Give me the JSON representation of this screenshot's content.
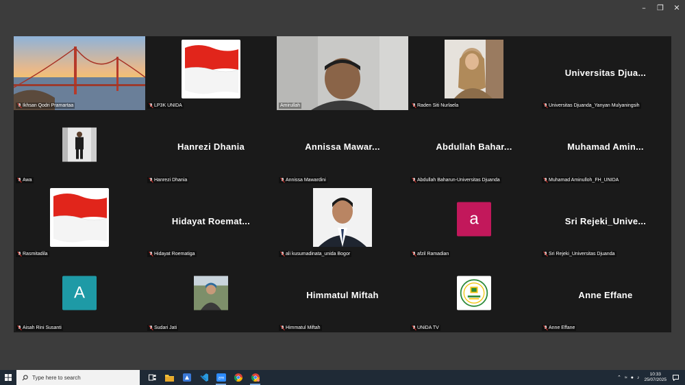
{
  "window_controls": {
    "minimize": "–",
    "restore": "❐",
    "close": "✕"
  },
  "participants": [
    {
      "name": "Ikhsan Qodri Pramartaa",
      "display": "bridge-photo"
    },
    {
      "name": "LP3K UNIDA",
      "display": "flag-photo"
    },
    {
      "name": "Amirullah",
      "display": "webcam",
      "active_speaker": true
    },
    {
      "name": "Raden Siti Nurlaela",
      "display": "portrait-woman"
    },
    {
      "name": "Universitas Djuanda_Yanyan Mulyaningsih",
      "big_name": "Universitas Djua..."
    },
    {
      "name": "Awa",
      "display": "standing-photo"
    },
    {
      "name": "Hanrezi Dhania",
      "big_name": "Hanrezi Dhania"
    },
    {
      "name": "Annissa Mawardini",
      "big_name": "Annissa Mawar..."
    },
    {
      "name": "Abdullah Baharun-Universitas Djuanda",
      "big_name": "Abdullah Bahar..."
    },
    {
      "name": "Muhamad Aminulloh_FH_UNIDA",
      "big_name": "Muhamad Amin..."
    },
    {
      "name": "Rasmitadila",
      "display": "flag-photo"
    },
    {
      "name": "Hidayat Roematiga",
      "big_name": "Hidayat Roemat..."
    },
    {
      "name": "ali kusumadinata_unida Bogor",
      "display": "portrait-man"
    },
    {
      "name": "afzil Ramadian",
      "letter": "a",
      "letter_color": "#c2185b"
    },
    {
      "name": "Sri Rejeki_Universitas Djuanda",
      "big_name": "Sri Rejeki_Unive..."
    },
    {
      "name": "Aisah Rini Susanti",
      "letter": "A",
      "letter_color": "#1e9aa6"
    },
    {
      "name": "Sudari Jati",
      "display": "outdoor-photo"
    },
    {
      "name": "Himmatul Miftah",
      "big_name": "Himmatul Miftah"
    },
    {
      "name": "UNiDA TV",
      "display": "university-logo"
    },
    {
      "name": "Anne Effane",
      "big_name": "Anne Effane"
    }
  ],
  "taskbar": {
    "search_placeholder": "Type here to search",
    "apps": [
      "task-view",
      "file-explorer",
      "paint",
      "vs-code",
      "zoom",
      "chrome",
      "chrome-profile"
    ],
    "time": "10:33",
    "date": "25/07/2025"
  },
  "colors": {
    "active_border": "#2ecc71",
    "grid_bg": "#1a1a1a",
    "page_bg": "#3c3c3c"
  }
}
